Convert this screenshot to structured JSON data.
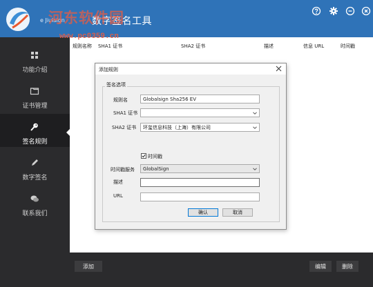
{
  "titlebar": {
    "title": "数字签名工具",
    "subtitle": "e Jiuisign",
    "watermark_line1": "河东软件园",
    "watermark_line2": "www.pc0359.cn",
    "accent": "#2f73b8",
    "controls": [
      "help-icon",
      "gear-icon",
      "minimize-icon",
      "close-icon"
    ]
  },
  "sidebar": {
    "items": [
      {
        "label": "功能介绍",
        "icon": "grid-icon"
      },
      {
        "label": "证书管理",
        "icon": "folder-icon"
      },
      {
        "label": "签名规则",
        "icon": "key-icon"
      },
      {
        "label": "数字签名",
        "icon": "pen-icon"
      },
      {
        "label": "联系我们",
        "icon": "chat-icon"
      }
    ],
    "active": "签名规则"
  },
  "table": {
    "columns": [
      "规则名称",
      "SHA1 证书",
      "SHA2 证书",
      "描述",
      "信息 URL",
      "时间戳"
    ]
  },
  "bottom": {
    "add": "添加",
    "edit": "编辑",
    "delete": "删除"
  },
  "dialog": {
    "title": "添加规则",
    "group": "签名选项",
    "rule_name_label": "规则名",
    "rule_name_value": "Globalsign Sha256 EV",
    "sha1_label": "SHA1 证书",
    "sha1_value": "",
    "sha2_label": "SHA2 证书",
    "sha2_value": "环玺信息科技（上海）有限公司",
    "timestamp_label": "时间戳",
    "timestamp_checked": true,
    "ts_service_label": "时间戳服务",
    "ts_service_value": "GlobalSign",
    "desc_label": "描述",
    "desc_value": "",
    "url_label": "URL",
    "url_value": "",
    "ok": "确认",
    "cancel": "取消"
  }
}
